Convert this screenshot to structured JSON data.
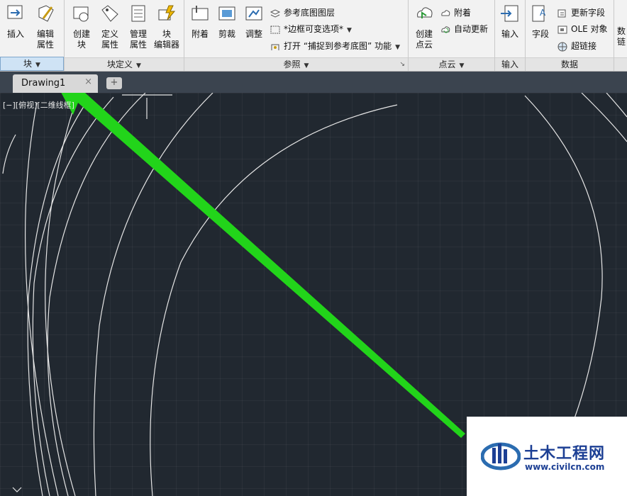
{
  "ribbon": {
    "panels": {
      "block": {
        "title": "块",
        "buttons": [
          {
            "l1": "插入",
            "l2": ""
          },
          {
            "l1": "编辑",
            "l2": "属性"
          }
        ]
      },
      "block_def": {
        "title": "块定义",
        "buttons": [
          {
            "l1": "创建",
            "l2": "块"
          },
          {
            "l1": "定义",
            "l2": "属性"
          },
          {
            "l1": "管理",
            "l2": "属性"
          },
          {
            "l1": "块",
            "l2": "编辑器"
          }
        ]
      },
      "reference": {
        "title": "参照",
        "buttons": [
          {
            "l1": "附着"
          },
          {
            "l1": "剪裁"
          },
          {
            "l1": "调整"
          }
        ],
        "small": [
          "参考底图图层",
          "*边框可变选项*",
          "打开 “捕捉到参考底图” 功能"
        ]
      },
      "pointcloud": {
        "title": "点云",
        "create": {
          "l1": "创建",
          "l2": "点云"
        },
        "small": [
          "附着",
          "自动更新"
        ]
      },
      "import": {
        "title": "输入",
        "button": "输入"
      },
      "data": {
        "title": "数据",
        "field": "字段",
        "small": [
          "更新字段",
          "OLE 对象",
          "超链接"
        ]
      },
      "partial": {
        "l1": "数",
        "l2": "链"
      }
    }
  },
  "doc_tab": {
    "label": "Drawing1",
    "close": "×",
    "new": "+"
  },
  "viewport_label": "[−][俯视][二维线框]",
  "watermark": {
    "brand": "土木工程网",
    "url": "www.civilcn.com"
  },
  "colors": {
    "canvas_bg": "#212830",
    "arrow": "#22d41a",
    "ribbon_bg": "#f2f2f2",
    "active_panel": "#cfe3f5",
    "watermark_text": "#1c3f94"
  }
}
